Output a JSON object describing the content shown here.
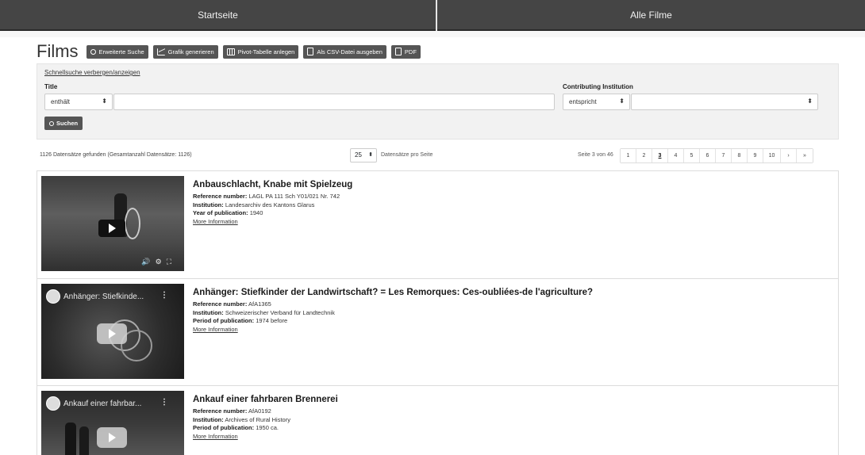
{
  "nav": {
    "home": "Startseite",
    "all_films": "Alle Filme"
  },
  "page": {
    "title": "Films"
  },
  "toolbar": {
    "advanced_search": "Erweiterte Suche",
    "generate_chart": "Grafik generieren",
    "pivot_table": "Pivot-Tabelle anlegen",
    "csv_export": "Als CSV-Datei ausgeben",
    "pdf": "PDF"
  },
  "quicksearch": {
    "toggle_link": "Schnellsuche verbergen/anzeigen",
    "title_label": "Title",
    "title_operator": "enthält",
    "title_value": "",
    "institution_label": "Contributing Institution",
    "institution_operator": "entspricht",
    "institution_value": "",
    "search_button": "Suchen"
  },
  "results": {
    "count_text": "1126 Datensätze gefunden  (Gesamtanzahl Datensätze: 1126)",
    "per_page": "25",
    "per_page_label": "Datensätze pro Seite",
    "page_info": "Seite 3 von 46",
    "pages": [
      "1",
      "2",
      "3",
      "4",
      "5",
      "6",
      "7",
      "8",
      "9",
      "10",
      "›",
      "»"
    ],
    "current_page": "3"
  },
  "labels": {
    "reference": "Reference number:",
    "institution": "Institution:",
    "year": "Year of publication:",
    "period": "Period of publication:",
    "more": "More Information"
  },
  "records": [
    {
      "title": "Anbauschlacht, Knabe mit Spielzeug",
      "reference": "LAGL PA 111 Sch Y01/021 Nr. 742",
      "institution": "Landesarchiv des Kantons Glarus",
      "date_value": "1940",
      "video_caption": ""
    },
    {
      "title": "Anhänger: Stiefkinder der Landwirtschaft? = Les Remorques: Ces-oubliées-de l'agriculture?",
      "reference": "AfA1365",
      "institution": "Schweizerischer Verband für Landtechnik",
      "date_value": "1974 before",
      "video_caption": "Anhänger: Stiefkinde..."
    },
    {
      "title": "Ankauf einer fahrbaren Brennerei",
      "reference": "AfA0192",
      "institution": "Archives of Rural History",
      "date_value": "1950 ca.",
      "video_caption": "Ankauf einer fahrbar..."
    }
  ]
}
